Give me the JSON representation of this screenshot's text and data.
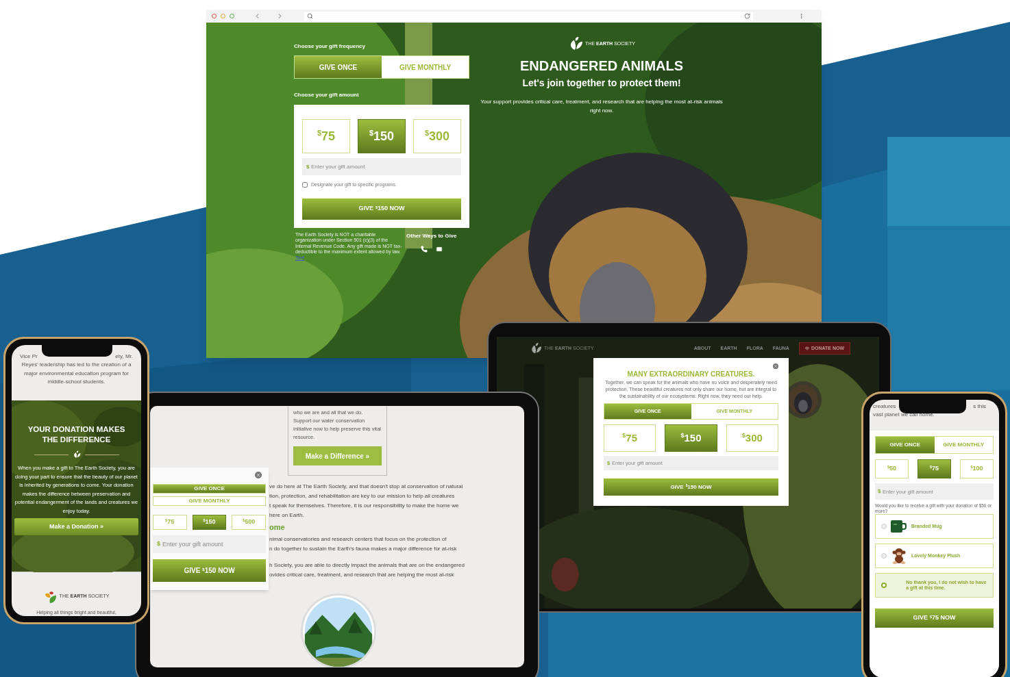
{
  "browser": {
    "hero": {
      "logo": "THE **EARTH** SOCIETY",
      "title": "ENDANGERED ANIMALS",
      "subtitle": "Let's join together to protect them!",
      "text": "Your support provides critical care, treatment, and research that are helping the most at-risk animals right now."
    },
    "form": {
      "frequency_label": "Choose your gift frequency",
      "frequencies": [
        {
          "label": "GIVE ONCE",
          "selected": true
        },
        {
          "label": "GIVE MONTHLY",
          "selected": false
        }
      ],
      "amount_label": "Choose your gift amount",
      "amounts": [
        {
          "currency": "$",
          "value": "75",
          "selected": false
        },
        {
          "currency": "$",
          "value": "150",
          "selected": true
        },
        {
          "currency": "$",
          "value": "300",
          "selected": false
        }
      ],
      "custom": {
        "currency": "$",
        "placeholder": "Enter your gift amount"
      },
      "designate": {
        "label": "Designate your gift to specific programs.",
        "checked": false
      },
      "submit": {
        "prefix": "GIVE",
        "currency": "$",
        "value": "150 NOW"
      }
    },
    "disclaimer": {
      "text": "The Earth Society is NOT a charitable organization under Section 501 (c)(3) of the Internal Revenue Code. Any gift made is NOT tax-deductible to the maximum extent allowed by law.",
      "link": "Text"
    },
    "other_ways": "Other Ways to Give"
  },
  "phone_left": {
    "top_fragments": [
      "Vice Pr",
      "ety, Mr."
    ],
    "intro": "Reyes' leadership has led to the creation of a major environmental education program for middle-school students.",
    "heading": "YOUR DONATION MAKES THE DIFFERENCE",
    "text": "When you make a gift to The Earth Society, you are doing your part to ensure that the beauty of our planet is inherited by generations to come. Your donation makes the difference between preservation and potential endangerment of the lands and creatures we enjoy today.",
    "button": "Make a Donation »",
    "footer_logo": "THE **EARTH** SOCIETY",
    "tagline": "Helping all things bright and beautiful,"
  },
  "tablet_middle": {
    "card": {
      "text": "who we are and all that we do. Support our water conservation initiative now to help preserve this vital resource.",
      "button": "Make a Difference »"
    },
    "lines": [
      "ve do here at The Earth Society, and that doesn't stop at conservation of natural",
      "tion, protection, and rehabilitation are key to our mission to help all creatures",
      "t speak for themselves. Therefore, it is our responsibility to make the home we",
      "here on Earth."
    ],
    "heading": "ome",
    "lines2": [
      "nimal conservatories and research centers that focus on the protection of",
      "n do together to sustain the Earth's fauna makes a major difference for at-risk"
    ],
    "lines3": [
      "h Society, you are able to directly impact the animals that are on the endangered",
      "ovides critical care, treatment, and research that are helping the most at-risk"
    ],
    "popup": {
      "frequencies": [
        {
          "label": "GIVE ONCE",
          "selected": true
        },
        {
          "label": "GIVE MONTHLY",
          "selected": false
        }
      ],
      "amounts": [
        {
          "currency": "$",
          "value": "75",
          "selected": false
        },
        {
          "currency": "$",
          "value": "150",
          "selected": true
        },
        {
          "currency": "$",
          "value": "500",
          "selected": false
        }
      ],
      "custom": {
        "currency": "$",
        "placeholder": "Enter your gift amount"
      },
      "submit": {
        "prefix": "GIVE",
        "currency": "$",
        "value": "150 NOW"
      }
    }
  },
  "tablet_right": {
    "logo": "THE **EARTH** SOCIETY",
    "nav": [
      "ABOUT",
      "EARTH",
      "FLORA",
      "FAUNA"
    ],
    "donate": "DONATE NOW",
    "popup": {
      "title": "MANY EXTRAORDINARY CREATURES.",
      "text": "Together, we can speak for the animals who have no voice and desperately need protection. These beautiful creatures not only share our home, but are integral to the sustainability of our ecosystems. Right now, they need our help.",
      "frequencies": [
        {
          "label": "GIVE ONCE",
          "selected": true
        },
        {
          "label": "GIVE MONTHLY",
          "selected": false
        }
      ],
      "amounts": [
        {
          "currency": "$",
          "value": "75",
          "selected": false
        },
        {
          "currency": "$",
          "value": "150",
          "selected": true
        },
        {
          "currency": "$",
          "value": "300",
          "selected": false
        }
      ],
      "custom": {
        "currency": "$",
        "placeholder": "Enter your gift amount"
      },
      "submit": {
        "prefix": "GIVE",
        "currency": "$",
        "value": "150 NOW"
      }
    }
  },
  "phone_right": {
    "top_fragments": [
      "creatures",
      "s this"
    ],
    "top_line": "vast planet we call home.",
    "frequencies": [
      {
        "label": "GIVE ONCE",
        "selected": true
      },
      {
        "label": "GIVE MONTHLY",
        "selected": false
      }
    ],
    "amounts": [
      {
        "currency": "$",
        "value": "50",
        "selected": false
      },
      {
        "currency": "$",
        "value": "75",
        "selected": true
      },
      {
        "currency": "$",
        "value": "100",
        "selected": false
      }
    ],
    "custom": {
      "currency": "$",
      "placeholder": "Enter your gift amount"
    },
    "question": "Would you like to receive a gift with your donation of $50 or more?",
    "gifts": [
      {
        "kind": "mug",
        "label": "Branded Mug",
        "selected": false
      },
      {
        "kind": "plush",
        "label": "Lovely Monkey Plush",
        "selected": false
      },
      {
        "kind": "none",
        "label": "No thank you, I do not wish to have a gift at this time.",
        "selected": true
      }
    ],
    "submit": {
      "prefix": "GIVE",
      "currency": "$",
      "value": "75 NOW"
    }
  }
}
